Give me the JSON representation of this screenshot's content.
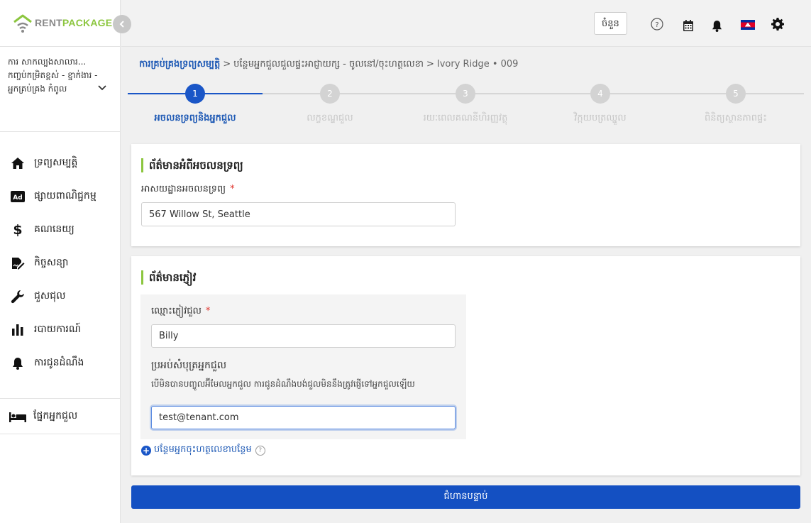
{
  "brand": {
    "rent": "RENT",
    "package": "PACKAGE"
  },
  "sidebar": {
    "organization": "ការ សាកល្បងសាលារ... កញ្ចប់កម្រិតខ្ពស់ - ខ្នាក់ងារ - អ្នកគ្រប់គ្រង កំពូល",
    "items": [
      {
        "label": "ទ្រព្យសម្បត្តិ",
        "icon": "home-icon"
      },
      {
        "label": "ផ្សាយពាណិជ្ជកម្ម",
        "icon": "ad-icon"
      },
      {
        "label": "គណនេយ្យ",
        "icon": "dollar-icon"
      },
      {
        "label": "កិច្ចសន្យា",
        "icon": "contract-icon"
      },
      {
        "label": "ជួសជុល",
        "icon": "wrench-icon"
      },
      {
        "label": "របាយការណ៍",
        "icon": "bar-chart-icon"
      },
      {
        "label": "ការជូនដំណឹង",
        "icon": "bell-icon"
      }
    ],
    "bottom_item": {
      "label": "ផ្នែកអ្នកជួល",
      "icon": "bed-icon"
    }
  },
  "topbar": {
    "count_button": "ចំនួន"
  },
  "breadcrumb": {
    "root": "ការគ្រប់គ្រងទ្រព្យសម្បត្តិ",
    "middle": "បន្ថែមអ្នកជួលជួលផ្ទះអាជ្ញាយក្ស - ចូលនៅ/ចុះហត្ថលេខា",
    "current": "Ivory Ridge • 009"
  },
  "steps": [
    {
      "number": "1",
      "label": "អចលនទ្រព្យនិងអ្នកជួល",
      "active": true
    },
    {
      "number": "2",
      "label": "លក្ខខណ្ឌជួល",
      "active": false
    },
    {
      "number": "3",
      "label": "រយៈពេលគណនីហិរញ្ញវត្ថុ",
      "active": false
    },
    {
      "number": "4",
      "label": "វិក្កយបត្រឈ្នួល",
      "active": false
    },
    {
      "number": "5",
      "label": "ពិនិត្យស្ថានភាពផ្ទះ",
      "active": false
    }
  ],
  "property_section": {
    "title": "ព័ត៌មានអំពីអចលនទ្រព្យ",
    "address_label": "អាសយដ្ឋានអចលនទ្រព្យ",
    "address_value": "567 Willow St, Seattle"
  },
  "tenant_section": {
    "title": "ព័ត៌មានភ្ញៀវ",
    "name_label": "ឈ្មោះភ្ញៀវជួល",
    "name_value": "Billy",
    "email_label": "ប្រអប់សំបុត្រអ្នកជួល",
    "email_helper": "បើមិនបានបញ្ចូលអ៊ីមែលអ្នកជួល ការជូនដំណឹងបង់ជួលមិននឹងត្រូវផ្ញើទៅអ្នកជួលឡើយ",
    "email_value": "test@tenant.com",
    "add_link": "បន្ថែមអ្នកចុះហត្ថលេខាបន្ថែម"
  },
  "next_button": "ជំហានបន្ទាប់",
  "colors": {
    "primary": "#1a56c7",
    "accent_green": "#8cc63f",
    "required": "#e0322b"
  }
}
